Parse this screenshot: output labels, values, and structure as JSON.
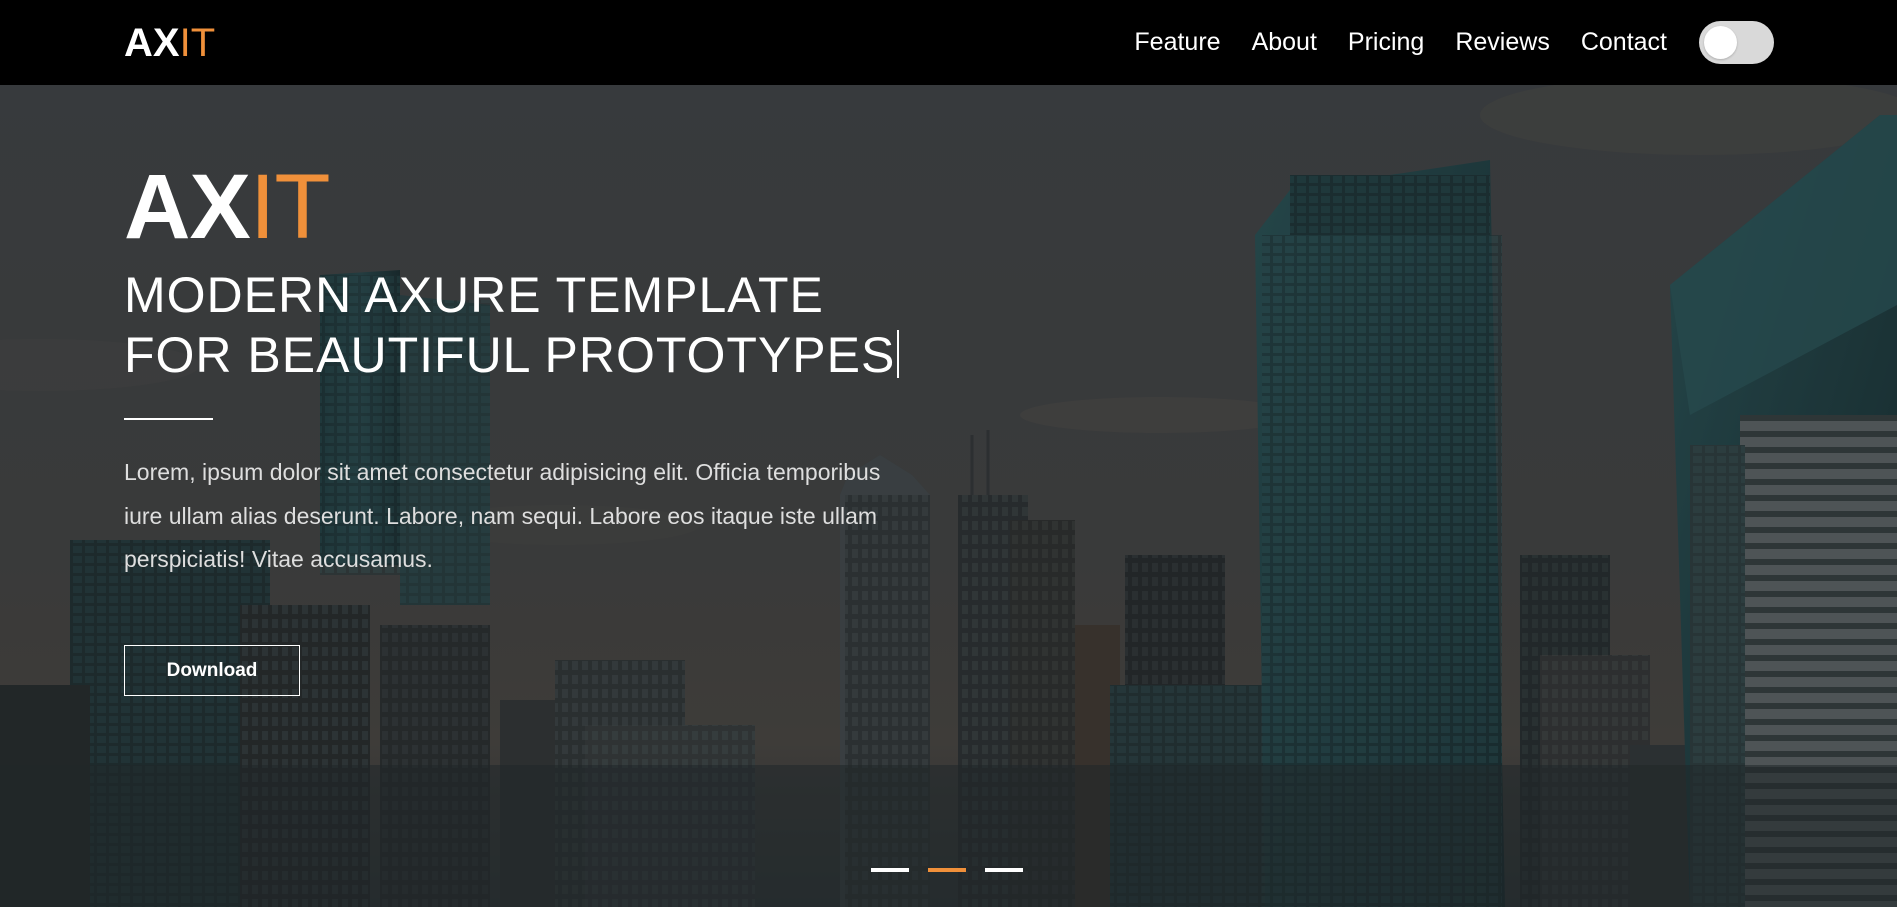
{
  "nav": {
    "logo_main": "AX",
    "logo_accent": "IT",
    "links": [
      "Feature",
      "About",
      "Pricing",
      "Reviews",
      "Contact"
    ],
    "theme_toggle_on": false
  },
  "hero": {
    "logo_main": "AX",
    "logo_accent": "IT",
    "headline_line1": "MODERN AXURE TEMPLATE",
    "headline_line2": "FOR BEAUTIFUL PROTOTYPES",
    "body": "Lorem, ipsum dolor sit amet consectetur adipisicing elit. Officia temporibus iure ullam alias deserunt. Labore, nam sequi. Labore eos itaque iste ullam perspiciatis! Vitae accusamus.",
    "download_label": "Download"
  },
  "slider": {
    "slide_count": 3,
    "active_index": 1
  },
  "colors": {
    "accent": "#f0903a",
    "nav_bg": "#000000",
    "text": "#ffffff"
  },
  "icons": {
    "theme_toggle": "toggle-switch-icon"
  }
}
